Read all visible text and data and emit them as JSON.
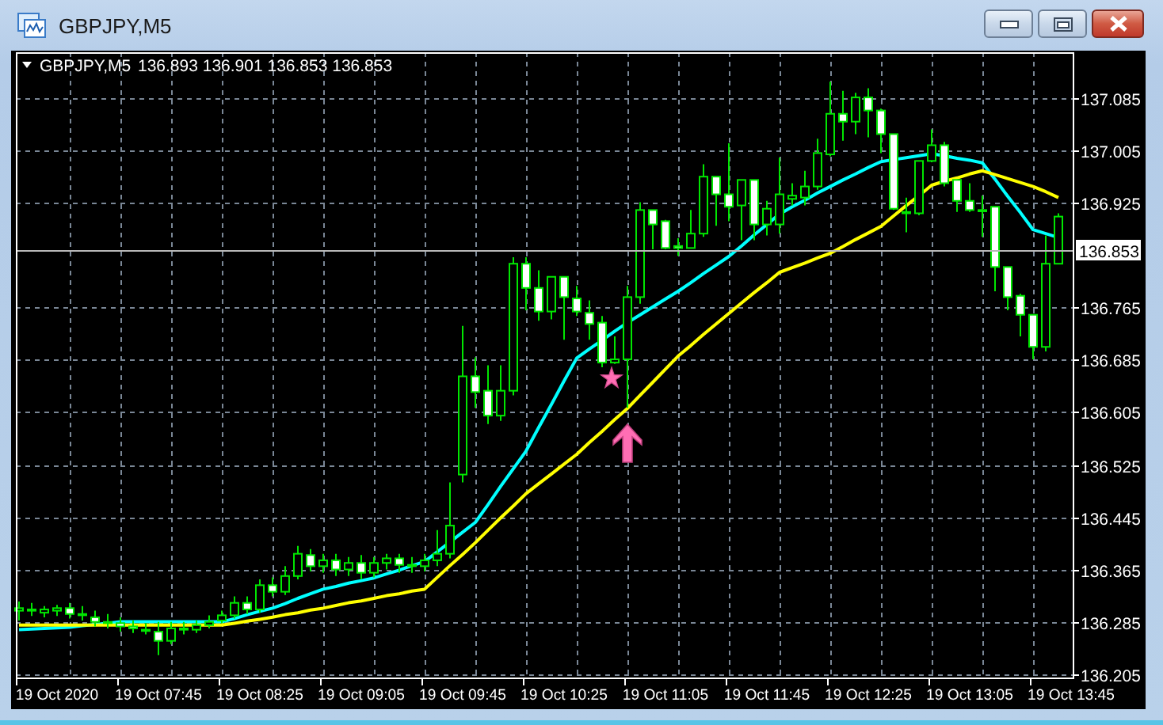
{
  "window": {
    "title": "GBPJPY,M5"
  },
  "chart": {
    "symbol": "GBPJPY,M5",
    "quote": "136.893 136.901 136.853 136.853",
    "current_price": "136.853",
    "chart_data": {
      "type": "candlestick",
      "categories": [
        null,
        null,
        null,
        "19 Oct 2020",
        null,
        null,
        null,
        null,
        null,
        null,
        null,
        "19 Oct 07:45",
        null,
        null,
        null,
        null,
        null,
        null,
        null,
        "19 Oct 08:25",
        null,
        null,
        null,
        null,
        null,
        null,
        null,
        "19 Oct 09:05",
        null,
        null,
        null,
        null,
        null,
        null,
        null,
        "19 Oct 09:45",
        null,
        null,
        null,
        null,
        null,
        null,
        null,
        "19 Oct 10:25",
        null,
        null,
        null,
        null,
        null,
        null,
        null,
        "19 Oct 11:05",
        null,
        null,
        null,
        null,
        null,
        null,
        null,
        "19 Oct 11:45",
        null,
        null,
        null,
        null,
        null,
        null,
        null,
        "19 Oct 12:25",
        null,
        null,
        null,
        null,
        null,
        null,
        null,
        "19 Oct 13:05",
        null,
        null,
        null,
        null,
        null,
        null,
        null,
        "19 Oct 13:45"
      ],
      "ohlc": [
        [
          136.302,
          136.316,
          136.287,
          136.306
        ],
        [
          136.304,
          136.314,
          136.294,
          136.302
        ],
        [
          136.299,
          136.309,
          136.292,
          136.304
        ],
        [
          136.302,
          136.311,
          136.294,
          136.306
        ],
        [
          136.306,
          136.314,
          136.29,
          136.297
        ],
        [
          136.297,
          136.309,
          136.287,
          136.297
        ],
        [
          136.292,
          136.302,
          136.278,
          136.285
        ],
        [
          136.285,
          136.297,
          136.275,
          136.285
        ],
        [
          136.283,
          136.292,
          136.27,
          136.278
        ],
        [
          136.278,
          136.287,
          136.268,
          136.275
        ],
        [
          136.273,
          136.283,
          136.266,
          136.273
        ],
        [
          136.27,
          136.285,
          136.234,
          136.256
        ],
        [
          136.256,
          136.285,
          136.251,
          136.275
        ],
        [
          136.275,
          136.285,
          136.266,
          136.273
        ],
        [
          136.273,
          136.287,
          136.268,
          136.28
        ],
        [
          136.28,
          136.295,
          136.275,
          136.285
        ],
        [
          136.287,
          136.302,
          136.283,
          136.295
        ],
        [
          136.295,
          136.324,
          136.29,
          136.314
        ],
        [
          136.314,
          136.324,
          136.297,
          136.304
        ],
        [
          136.304,
          136.35,
          136.299,
          136.341
        ],
        [
          136.341,
          136.353,
          136.324,
          136.331
        ],
        [
          136.331,
          136.37,
          136.326,
          136.355
        ],
        [
          136.355,
          136.401,
          136.35,
          136.389
        ],
        [
          136.387,
          136.396,
          136.362,
          136.37
        ],
        [
          136.37,
          136.389,
          136.36,
          136.379
        ],
        [
          136.379,
          136.389,
          136.355,
          136.365
        ],
        [
          136.365,
          136.384,
          136.355,
          136.375
        ],
        [
          136.375,
          136.387,
          136.35,
          136.36
        ],
        [
          136.36,
          136.384,
          136.353,
          136.375
        ],
        [
          136.375,
          136.389,
          136.365,
          136.382
        ],
        [
          136.382,
          136.389,
          136.36,
          136.372
        ],
        [
          136.372,
          136.384,
          136.36,
          136.37
        ],
        [
          136.37,
          136.389,
          136.362,
          136.379
        ],
        [
          136.379,
          136.425,
          136.37,
          136.389
        ],
        [
          136.389,
          136.498,
          136.382,
          136.432
        ],
        [
          136.51,
          136.737,
          136.498,
          136.66
        ],
        [
          136.66,
          136.689,
          136.612,
          136.636
        ],
        [
          136.638,
          136.677,
          136.587,
          136.6
        ],
        [
          136.6,
          136.677,
          136.592,
          136.638
        ],
        [
          136.638,
          136.842,
          136.631,
          136.832
        ],
        [
          136.832,
          136.842,
          136.761,
          136.795
        ],
        [
          136.795,
          136.822,
          136.745,
          136.759
        ],
        [
          136.759,
          136.812,
          136.747,
          136.812
        ],
        [
          136.812,
          136.812,
          136.716,
          136.781
        ],
        [
          136.779,
          136.798,
          136.752,
          136.759
        ],
        [
          136.757,
          136.776,
          136.716,
          136.74
        ],
        [
          136.742,
          136.752,
          136.674,
          136.681
        ],
        [
          136.681,
          136.721,
          136.679,
          136.686
        ],
        [
          136.686,
          136.798,
          136.612,
          136.781
        ],
        [
          136.781,
          136.926,
          136.771,
          136.914
        ],
        [
          136.914,
          136.914,
          136.854,
          136.892
        ],
        [
          136.897,
          136.899,
          136.854,
          136.856
        ],
        [
          136.859,
          136.871,
          136.844,
          136.856
        ],
        [
          136.856,
          136.914,
          136.856,
          136.878
        ],
        [
          136.878,
          136.984,
          136.873,
          136.965
        ],
        [
          136.965,
          136.965,
          136.89,
          136.938
        ],
        [
          136.938,
          137.016,
          136.897,
          136.919
        ],
        [
          136.921,
          136.96,
          136.868,
          136.96
        ],
        [
          136.96,
          136.96,
          136.868,
          136.892
        ],
        [
          136.892,
          136.928,
          136.875,
          136.916
        ],
        [
          136.892,
          136.994,
          136.878,
          136.938
        ],
        [
          136.931,
          136.955,
          136.921,
          136.936
        ],
        [
          136.933,
          136.974,
          136.921,
          136.95
        ],
        [
          136.95,
          137.023,
          136.945,
          137.001
        ],
        [
          136.999,
          137.11,
          136.996,
          137.061
        ],
        [
          137.061,
          137.096,
          137.02,
          137.049
        ],
        [
          137.049,
          137.093,
          137.03,
          137.086
        ],
        [
          137.086,
          137.1,
          137.025,
          137.066
        ],
        [
          137.066,
          137.069,
          137.001,
          137.03
        ],
        [
          137.03,
          137.03,
          136.914,
          136.916
        ],
        [
          136.911,
          136.933,
          136.88,
          136.909
        ],
        [
          136.909,
          136.989,
          136.906,
          136.989
        ],
        [
          136.989,
          137.037,
          136.987,
          137.013
        ],
        [
          137.013,
          137.018,
          136.95,
          136.955
        ],
        [
          136.96,
          136.96,
          136.911,
          136.928
        ],
        [
          136.928,
          136.955,
          136.911,
          136.914
        ],
        [
          136.914,
          136.936,
          136.873,
          136.914
        ],
        [
          136.919,
          136.919,
          136.79,
          136.827
        ],
        [
          136.827,
          136.827,
          136.761,
          136.781
        ],
        [
          136.783,
          136.786,
          136.721,
          136.754
        ],
        [
          136.754,
          136.754,
          136.686,
          136.705
        ],
        [
          136.705,
          136.875,
          136.698,
          136.832
        ],
        [
          136.832,
          136.909,
          136.832,
          136.904
        ],
        null
      ],
      "series": [
        {
          "type": "line",
          "color": "#00ffff",
          "values": [
            136.273,
            136.274,
            136.275,
            136.276,
            136.277,
            136.279,
            136.281,
            136.283,
            136.285,
            136.285,
            136.285,
            136.285,
            136.285,
            136.285,
            136.285,
            136.285,
            136.285,
            136.29,
            136.296,
            136.301,
            136.306,
            136.313,
            136.321,
            136.328,
            136.335,
            136.339,
            136.344,
            136.348,
            136.352,
            136.358,
            136.364,
            136.371,
            136.377,
            136.392,
            136.407,
            136.422,
            136.437,
            136.464,
            136.492,
            136.519,
            136.546,
            136.582,
            136.617,
            136.653,
            136.688,
            136.702,
            136.715,
            136.729,
            136.742,
            136.754,
            136.766,
            136.778,
            136.79,
            136.803,
            136.817,
            136.83,
            136.843,
            136.859,
            136.876,
            136.892,
            136.908,
            136.919,
            136.929,
            136.94,
            136.95,
            136.96,
            136.969,
            136.979,
            136.988,
            136.991,
            136.994,
            136.997,
            137.0,
            136.997,
            136.993,
            136.99,
            136.986,
            136.961,
            136.935,
            136.91,
            136.884,
            136.878,
            136.872,
            null
          ]
        },
        {
          "type": "line",
          "color": "#ffff00",
          "values": [
            136.28,
            136.28,
            136.28,
            136.28,
            136.28,
            136.28,
            136.28,
            136.28,
            136.28,
            136.28,
            136.28,
            136.28,
            136.28,
            136.28,
            136.28,
            136.28,
            136.28,
            136.283,
            136.286,
            136.289,
            136.292,
            136.296,
            136.299,
            136.303,
            136.306,
            136.31,
            136.314,
            136.317,
            136.321,
            136.325,
            136.328,
            136.332,
            136.335,
            136.353,
            136.371,
            136.388,
            136.406,
            136.425,
            136.444,
            136.462,
            136.481,
            136.496,
            136.511,
            136.526,
            136.541,
            136.559,
            136.576,
            136.594,
            136.611,
            136.631,
            136.651,
            136.671,
            136.691,
            136.707,
            136.724,
            136.74,
            136.756,
            136.772,
            136.788,
            136.803,
            136.819,
            136.826,
            136.833,
            136.841,
            136.848,
            136.858,
            136.869,
            136.879,
            136.889,
            136.905,
            136.921,
            136.936,
            136.952,
            136.958,
            136.963,
            136.969,
            136.974,
            136.968,
            136.962,
            136.956,
            136.95,
            136.942,
            136.933,
            null
          ]
        }
      ],
      "ref_lines": [
        {
          "axis": "y",
          "value": 136.853,
          "color": "#b8b8b8"
        }
      ],
      "grid": true,
      "ylim": [
        136.2,
        137.155
      ],
      "yticks": [
        {
          "value": 137.085,
          "label": "137.085"
        },
        {
          "value": 137.005,
          "label": "137.005"
        },
        {
          "value": 136.925,
          "label": "136.925"
        },
        {
          "value": 136.765,
          "label": "136.765"
        },
        {
          "value": 136.685,
          "label": "136.685"
        },
        {
          "value": 136.605,
          "label": "136.605"
        },
        {
          "value": 136.525,
          "label": "136.525"
        },
        {
          "value": 136.445,
          "label": "136.445"
        },
        {
          "value": 136.365,
          "label": "136.365"
        },
        {
          "value": 136.285,
          "label": "136.285"
        },
        {
          "value": 136.205,
          "label": "136.205"
        }
      ]
    }
  }
}
